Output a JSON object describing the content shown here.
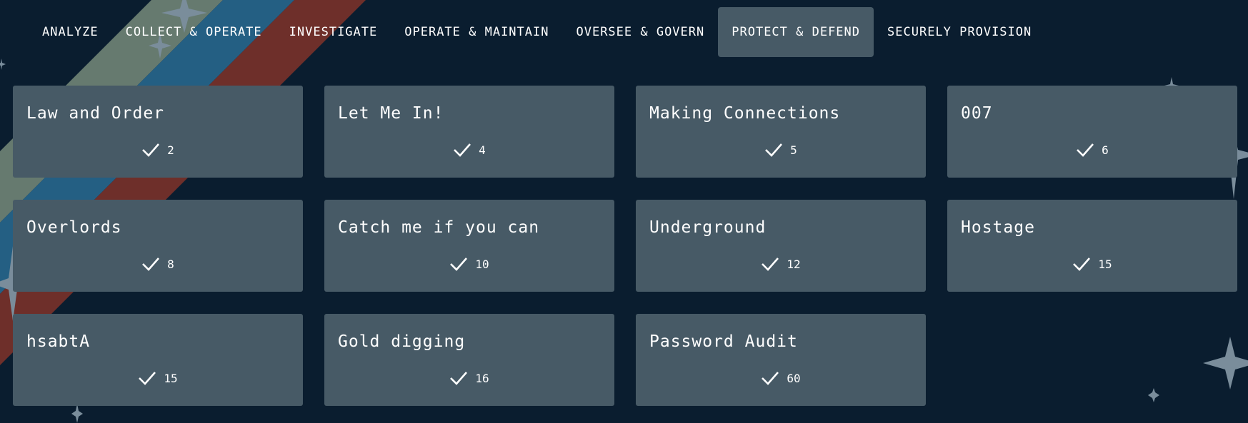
{
  "nav": {
    "active_index": 5,
    "tabs": [
      {
        "label": "ANALYZE"
      },
      {
        "label": "COLLECT & OPERATE"
      },
      {
        "label": "INVESTIGATE"
      },
      {
        "label": "OPERATE & MAINTAIN"
      },
      {
        "label": "OVERSEE & GOVERN"
      },
      {
        "label": "PROTECT & DEFEND"
      },
      {
        "label": "SECURELY PROVISION"
      }
    ]
  },
  "challenges": [
    {
      "title": "Law and Order",
      "icon": "check-icon",
      "solves": "2"
    },
    {
      "title": "Let Me In!",
      "icon": "check-icon",
      "solves": "4"
    },
    {
      "title": "Making Connections",
      "icon": "check-icon",
      "solves": "5"
    },
    {
      "title": "007",
      "icon": "check-icon",
      "solves": "6"
    },
    {
      "title": "Overlords",
      "icon": "check-icon",
      "solves": "8"
    },
    {
      "title": "Catch me if you can",
      "icon": "check-icon",
      "solves": "10"
    },
    {
      "title": "Underground",
      "icon": "check-icon",
      "solves": "12"
    },
    {
      "title": "Hostage",
      "icon": "check-icon",
      "solves": "15"
    },
    {
      "title": "hsabtA",
      "icon": "check-icon",
      "solves": "15"
    },
    {
      "title": "Gold digging",
      "icon": "check-icon",
      "solves": "16"
    },
    {
      "title": "Password Audit",
      "icon": "check-icon",
      "solves": "60"
    }
  ],
  "colors": {
    "background": "#0a1d2f",
    "card": "#475a66",
    "active_tab": "#475a66",
    "stripe_gray": "#667a6f",
    "stripe_blue": "#245f83",
    "stripe_red": "#6e2f2a",
    "star": "#7a8d9b"
  }
}
